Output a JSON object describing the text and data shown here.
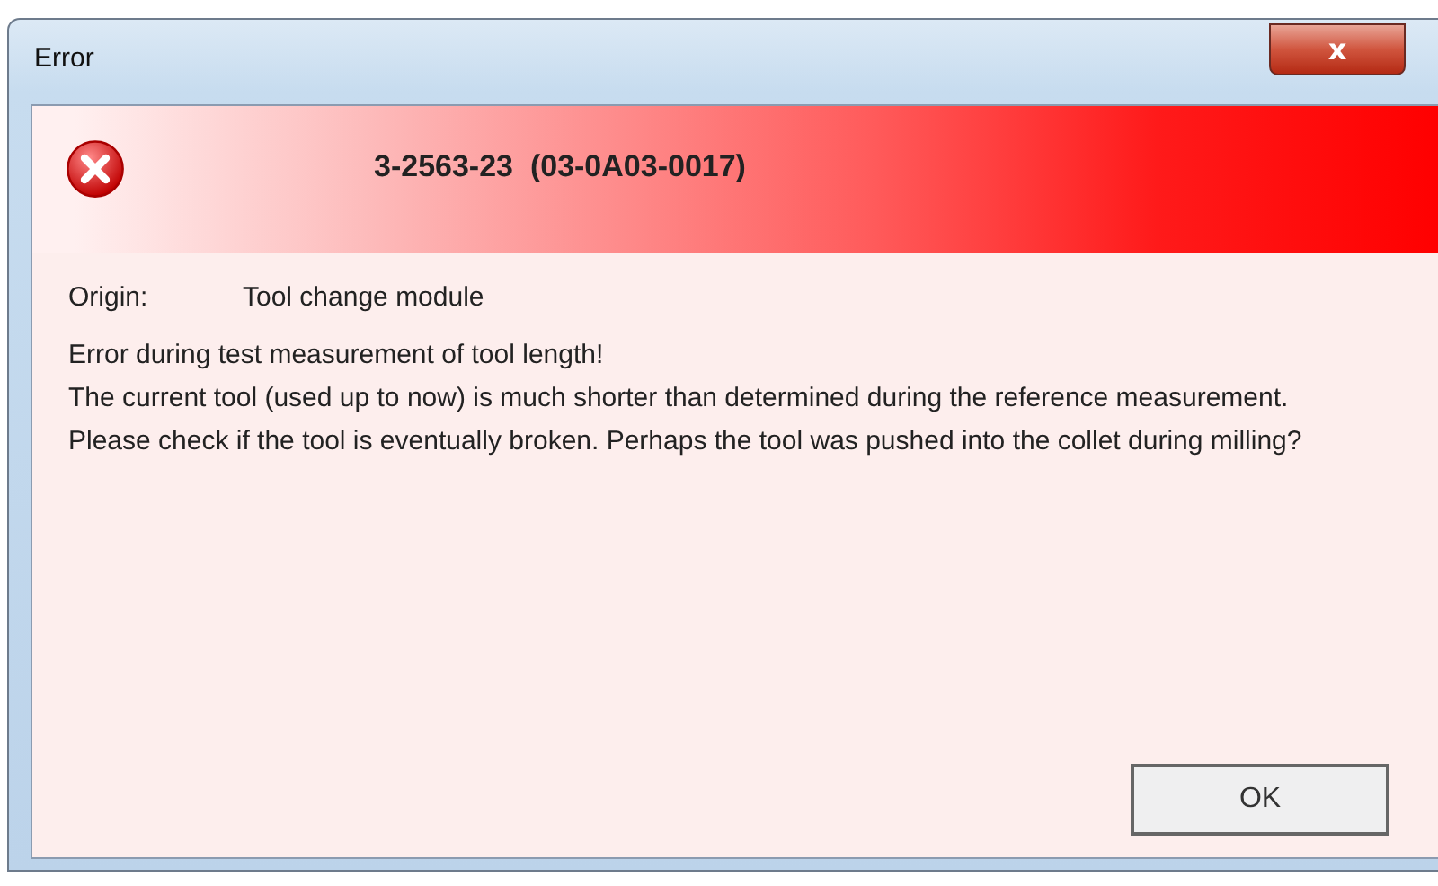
{
  "window": {
    "title": "Error",
    "close_label": "x"
  },
  "header": {
    "code": "3-2563-23  (03-0A03-0017)"
  },
  "origin": {
    "label": "Origin:",
    "value": "Tool change module"
  },
  "message": [
    "Error during test measurement of tool length!",
    "The current tool (used up to now) is much shorter than determined during the reference measurement. Please check if the tool is eventually broken. Perhaps the tool was pushed into the collet during milling?"
  ],
  "buttons": [
    "OK"
  ]
}
